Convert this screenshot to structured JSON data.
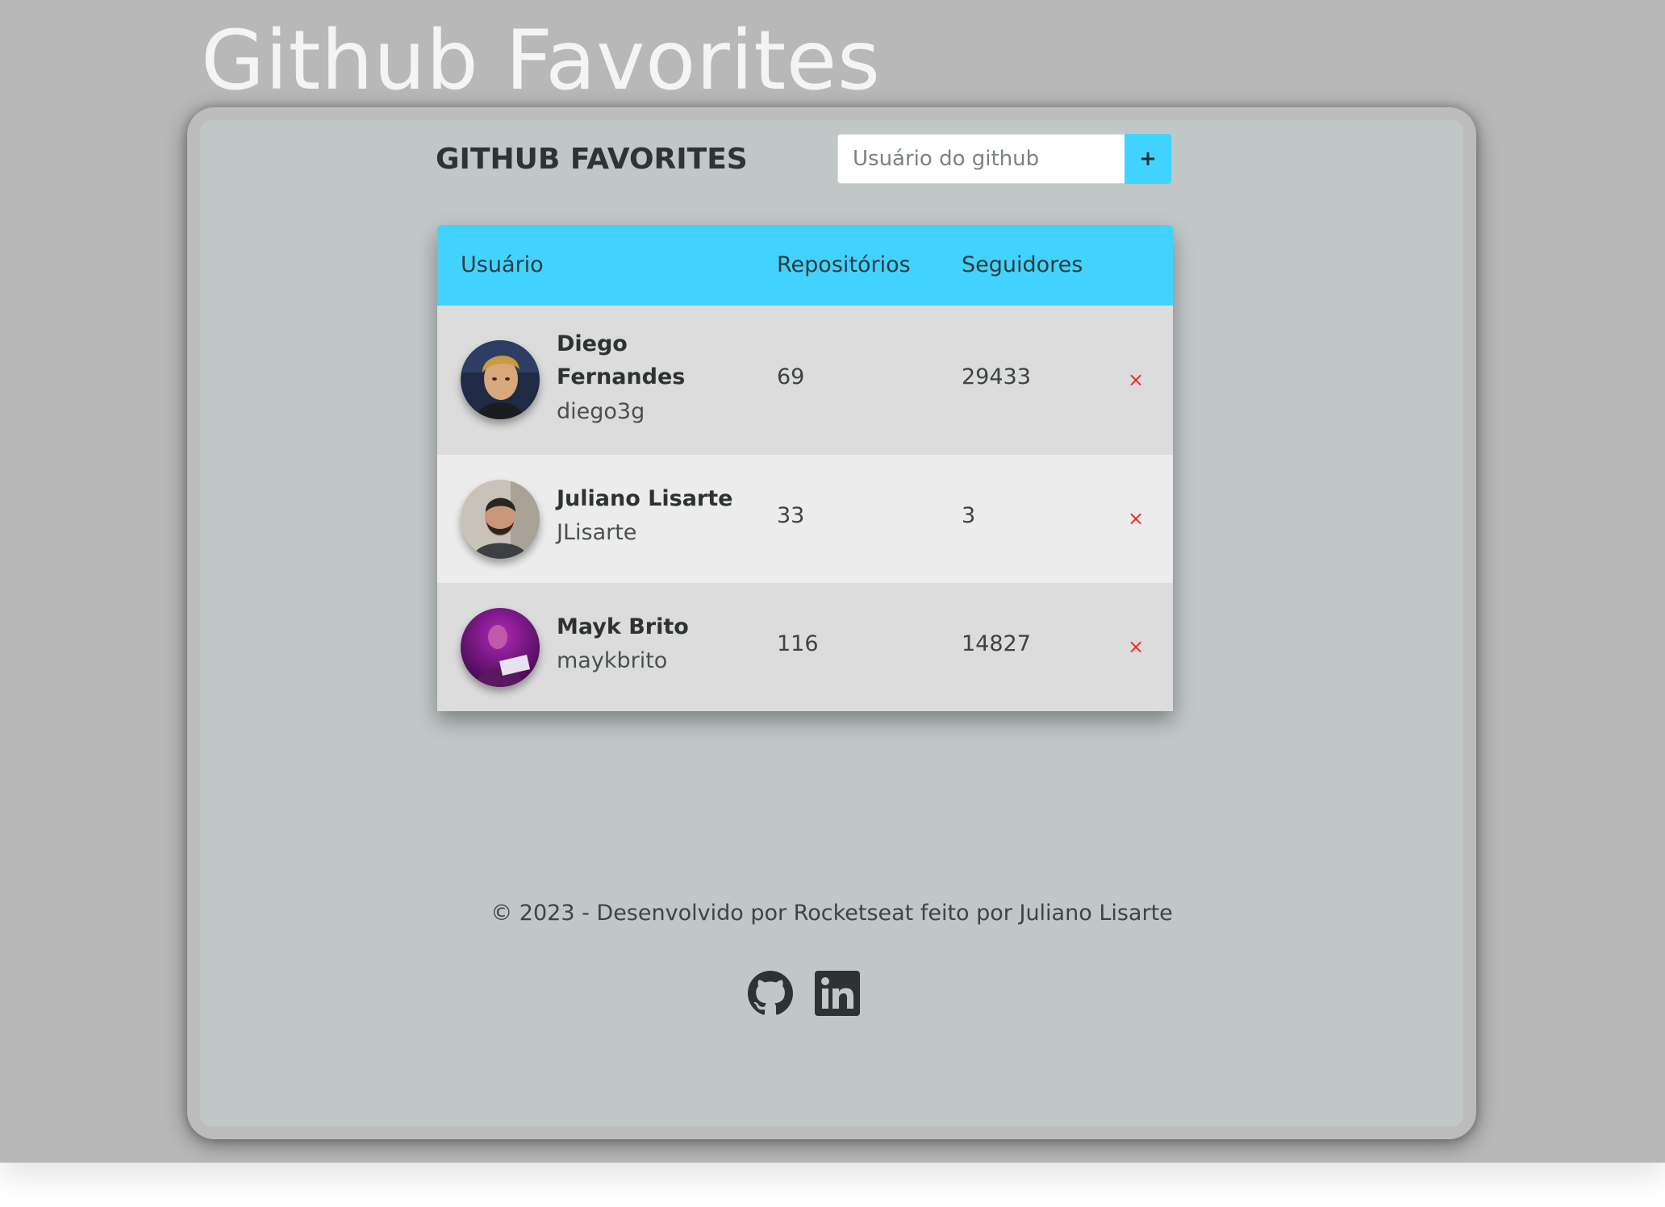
{
  "page": {
    "title": "Github Favorites"
  },
  "header": {
    "title": "GITHUB FAVORITES",
    "search_placeholder": "Usuário do github",
    "search_value": "",
    "add_label": "+"
  },
  "table": {
    "columns": [
      "Usuário",
      "Repositórios",
      "Seguidores"
    ],
    "rows": [
      {
        "name": "Diego Fernandes",
        "login": "diego3g",
        "repositories": "69",
        "followers": "29433",
        "remove_label": "×"
      },
      {
        "name": "Juliano Lisarte",
        "login": "JLisarte",
        "repositories": "33",
        "followers": "3",
        "remove_label": "×"
      },
      {
        "name": "Mayk Brito",
        "login": "maykbrito",
        "repositories": "116",
        "followers": "14827",
        "remove_label": "×"
      }
    ]
  },
  "footer": {
    "text": "© 2023 - Desenvolvido por Rocketseat feito por Juliano Lisarte",
    "links": [
      {
        "icon": "github-icon"
      },
      {
        "icon": "linkedin-icon"
      }
    ]
  },
  "colors": {
    "accent": "#41d3fd",
    "remove": "#f22a2a",
    "background": "#b8b8b8",
    "screen": "#c1c6c7"
  }
}
